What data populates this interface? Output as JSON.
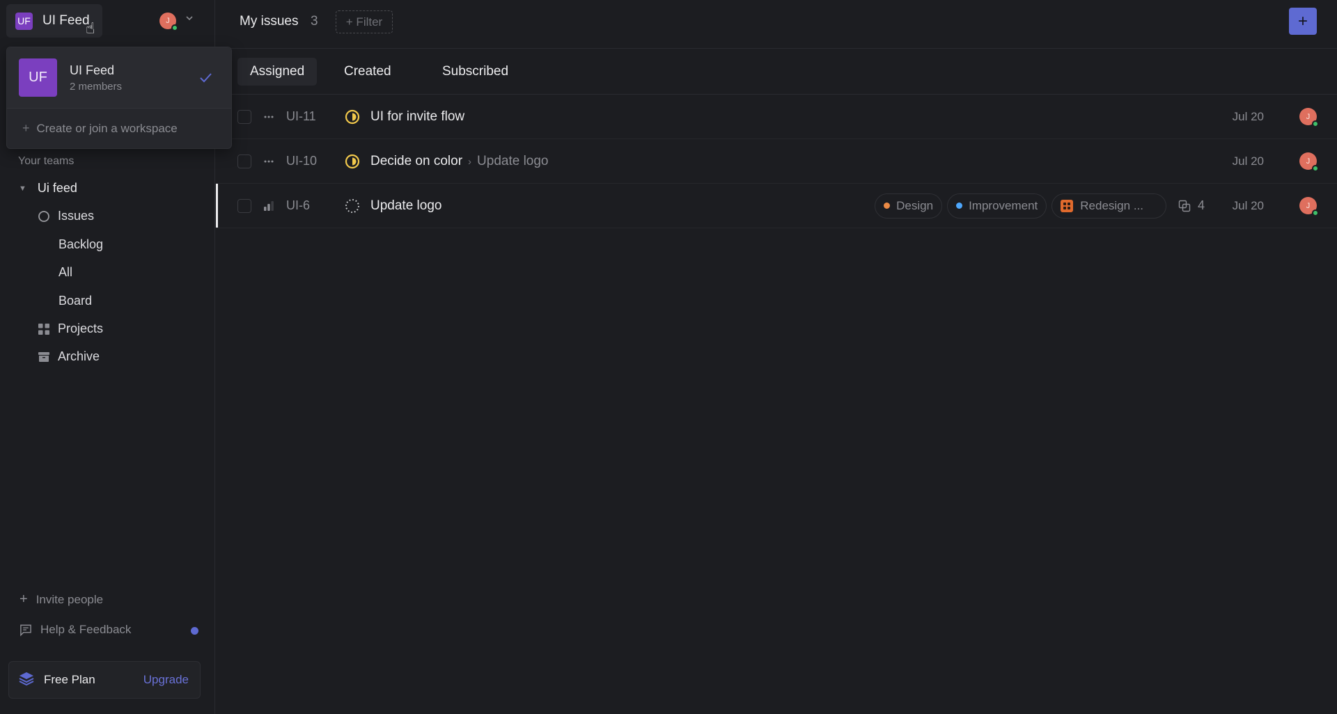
{
  "workspace": {
    "initials": "UF",
    "name": "UI Feed",
    "user_initial": "J",
    "brand_color": "#7b3fbf",
    "accent_color": "#5e6ad2"
  },
  "dropdown": {
    "items": [
      {
        "initials": "UF",
        "name": "UI Feed",
        "members": "2 members",
        "selected": true
      }
    ],
    "create_label": "Create or join a workspace"
  },
  "sidebar": {
    "teams_label": "Your teams",
    "team": {
      "name": "Ui feed"
    },
    "items": [
      {
        "label": "Issues",
        "icon": "circle-icon"
      },
      {
        "label": "Backlog"
      },
      {
        "label": "All"
      },
      {
        "label": "Board"
      },
      {
        "label": "Projects",
        "icon": "grid-icon"
      },
      {
        "label": "Archive",
        "icon": "archive-icon"
      }
    ],
    "invite_label": "Invite people",
    "help_label": "Help & Feedback",
    "plan_label": "Free Plan",
    "upgrade_label": "Upgrade"
  },
  "header": {
    "title": "My issues",
    "count": "3",
    "filter_label": "+ Filter",
    "new_issue_icon": "+"
  },
  "tabs": [
    {
      "label": "Assigned",
      "active": true
    },
    {
      "label": "Created",
      "active": false
    },
    {
      "label": "Subscribed",
      "active": false
    }
  ],
  "issues": [
    {
      "id": "UI-11",
      "priority": "no-priority",
      "status": "in-progress",
      "title": "UI for invite flow",
      "parent": "",
      "labels": [],
      "project": "",
      "sub_issues": "",
      "date": "Jul 20",
      "assignee": "J"
    },
    {
      "id": "UI-10",
      "priority": "no-priority",
      "status": "in-progress",
      "title": "Decide on color",
      "parent": "Update logo",
      "labels": [],
      "project": "",
      "sub_issues": "",
      "date": "Jul 20",
      "assignee": "J"
    },
    {
      "id": "UI-6",
      "priority": "medium",
      "status": "backlog",
      "title": "Update logo",
      "parent": "",
      "labels": [
        {
          "name": "Design",
          "color": "#eb8a45"
        },
        {
          "name": "Improvement",
          "color": "#4ea7fc"
        }
      ],
      "project": "Redesign ...",
      "sub_issues": "4",
      "date": "Jul 20",
      "assignee": "J"
    }
  ]
}
